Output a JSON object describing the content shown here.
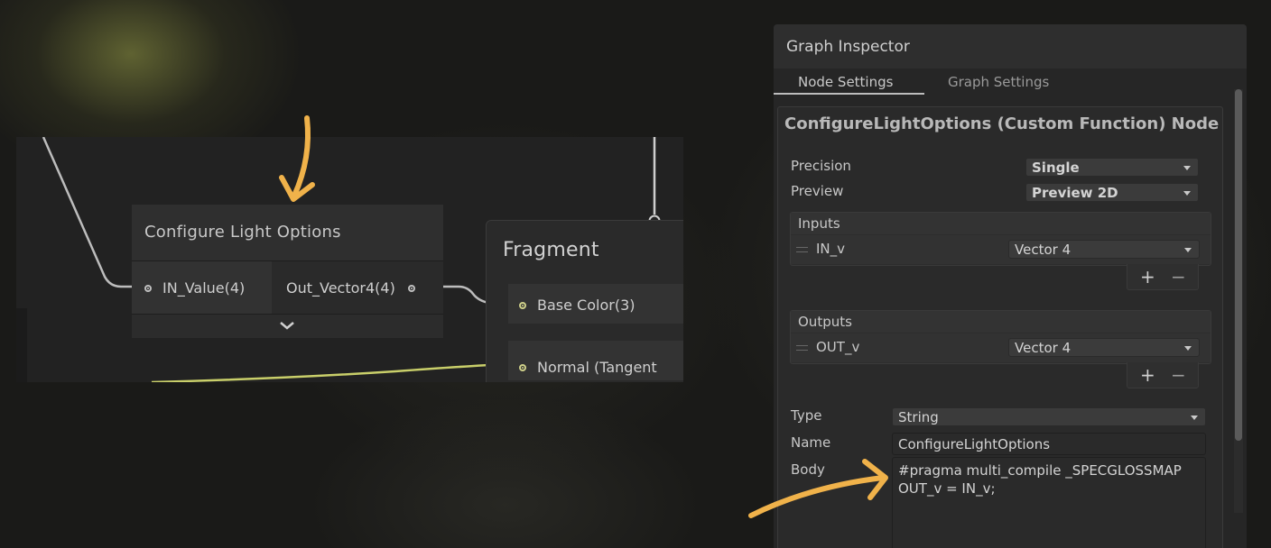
{
  "graph": {
    "node": {
      "title": "Configure Light Options",
      "input_port": "IN_Value(4)",
      "output_port": "Out_Vector4(4)"
    },
    "fragment": {
      "title": "Fragment",
      "ports": [
        "Base Color(3)",
        "Normal (Tangent"
      ]
    }
  },
  "inspector": {
    "title": "Graph Inspector",
    "tabs": [
      {
        "label": "Node Settings",
        "active": true
      },
      {
        "label": "Graph Settings",
        "active": false
      }
    ],
    "section_title": "ConfigureLightOptions (Custom Function) Node",
    "precision": {
      "label": "Precision",
      "value": "Single"
    },
    "preview": {
      "label": "Preview",
      "value": "Preview 2D"
    },
    "inputs": {
      "label": "Inputs",
      "row_name": "IN_v",
      "row_type": "Vector 4"
    },
    "outputs": {
      "label": "Outputs",
      "row_name": "OUT_v",
      "row_type": "Vector 4"
    },
    "add_label": "+",
    "remove_label": "−",
    "type": {
      "label": "Type",
      "value": "String"
    },
    "name": {
      "label": "Name",
      "value": "ConfigureLightOptions"
    },
    "body": {
      "label": "Body",
      "value": "#pragma multi_compile _SPECGLOSSMAP\nOUT_v = IN_v;"
    }
  },
  "colors": {
    "annotation_arrow": "#f0b24a",
    "wire_yellow": "#c9cf6a",
    "panel_bg": "#262626"
  }
}
